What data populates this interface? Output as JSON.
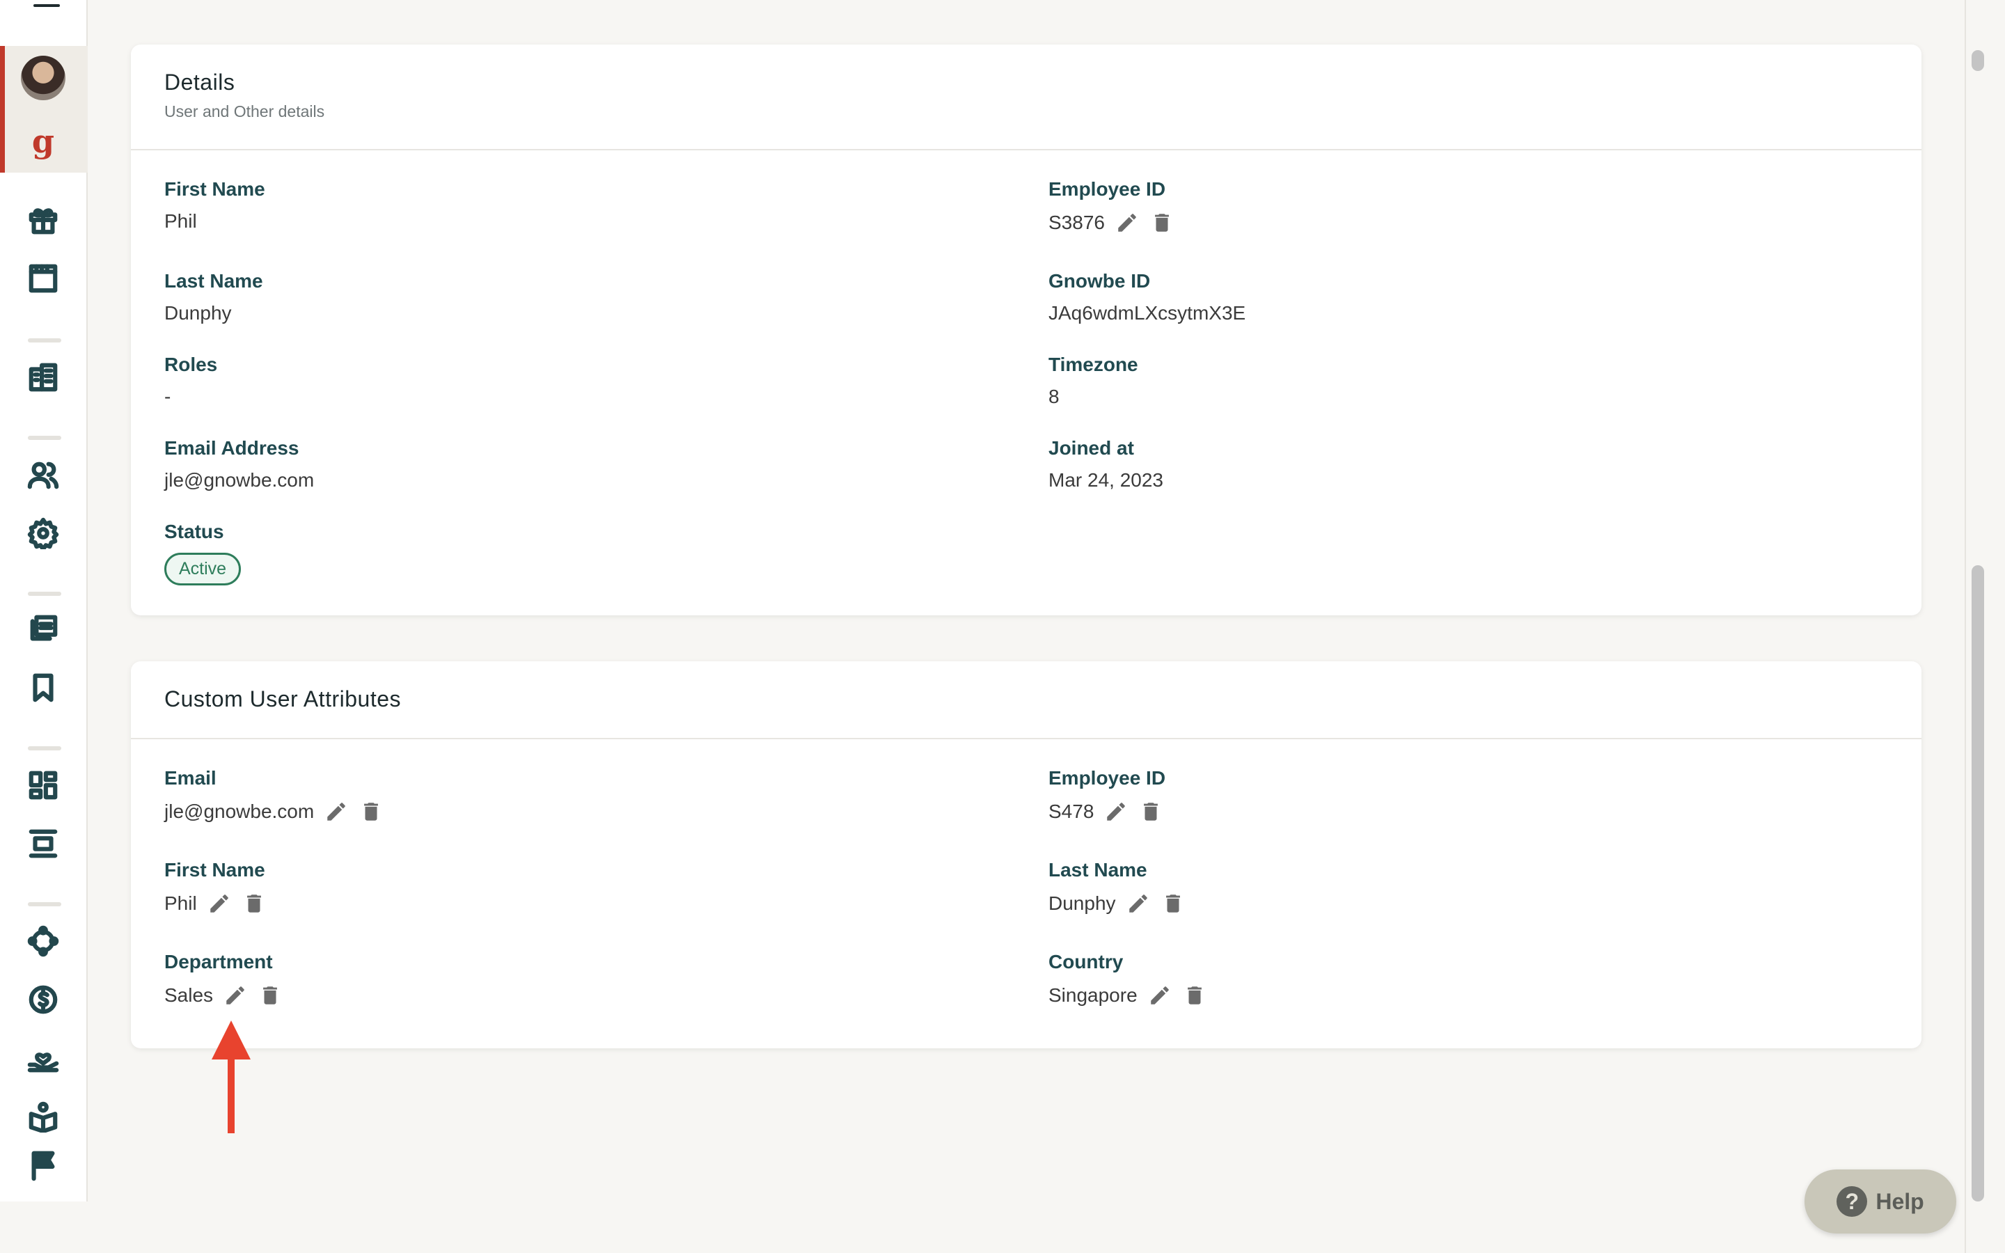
{
  "details": {
    "title": "Details",
    "subtitle": "User and Other details",
    "fields": {
      "first_name": {
        "label": "First Name",
        "value": "Phil"
      },
      "last_name": {
        "label": "Last Name",
        "value": "Dunphy"
      },
      "roles": {
        "label": "Roles",
        "value": "-"
      },
      "email": {
        "label": "Email Address",
        "value": "jle@gnowbe.com"
      },
      "status": {
        "label": "Status",
        "value": "Active"
      },
      "employee_id": {
        "label": "Employee ID",
        "value": "S3876"
      },
      "gnowbe_id": {
        "label": "Gnowbe ID",
        "value": "JAq6wdmLXcsytmX3E"
      },
      "timezone": {
        "label": "Timezone",
        "value": "8"
      },
      "joined_at": {
        "label": "Joined at",
        "value": "Mar 24, 2023"
      }
    }
  },
  "custom_attributes": {
    "title": "Custom User Attributes",
    "fields": {
      "email": {
        "label": "Email",
        "value": "jle@gnowbe.com"
      },
      "employee_id": {
        "label": "Employee ID",
        "value": "S478"
      },
      "first_name": {
        "label": "First Name",
        "value": "Phil"
      },
      "last_name": {
        "label": "Last Name",
        "value": "Dunphy"
      },
      "department": {
        "label": "Department",
        "value": "Sales"
      },
      "country": {
        "label": "Country",
        "value": "Singapore"
      }
    }
  },
  "help": {
    "label": "Help",
    "icon": "question-icon"
  },
  "colors": {
    "accent": "#c0392b",
    "label": "#214a50",
    "status_active": "#2e7d5b",
    "annotation_arrow": "#e8432e"
  },
  "sidebar": {
    "icons": [
      "avatar",
      "gnowbe-logo",
      "gift-icon",
      "frame-icon",
      "building-icon",
      "users-icon",
      "gear-icon",
      "library-icon",
      "bookmark-icon",
      "dashboard-icon",
      "layout-icon",
      "network-icon",
      "dollar-icon",
      "hand-heart-icon",
      "open-book-icon",
      "flag-icon"
    ]
  }
}
